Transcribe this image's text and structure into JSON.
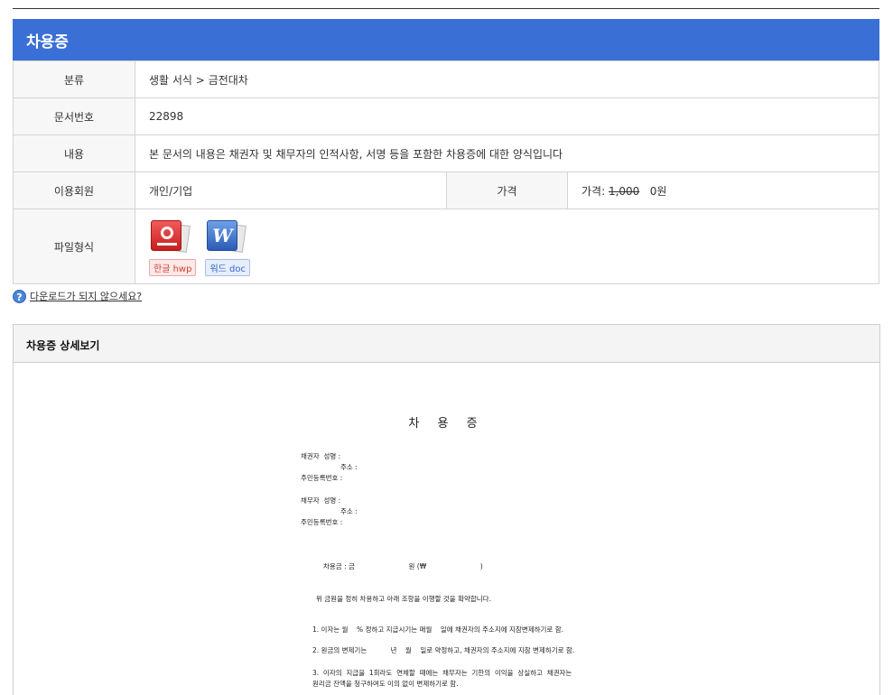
{
  "header": {
    "title": "차용증"
  },
  "info": {
    "category_label": "분류",
    "category_value": "생활 서식 > 금전대차",
    "docno_label": "문서번호",
    "docno_value": "22898",
    "content_label": "내용",
    "content_value": "본 문서의 내용은 채권자 및 채무자의 인적사항, 서명 등을 포함한 차용증에 대한 양식입니다",
    "member_label": "이용회원",
    "member_value": "개인/기업",
    "price_label": "가격",
    "price_prefix": "가격: ",
    "price_original": "1,000",
    "price_final": "0원",
    "fileformat_label": "파일형식",
    "files": [
      {
        "label": "한글 hwp",
        "icon": "hwp-icon"
      },
      {
        "label": "워드 doc",
        "icon": "word-icon"
      }
    ]
  },
  "help": {
    "text": "다운로드가 되지 않으세요?"
  },
  "detail": {
    "title": "차용증 상세보기",
    "doc": {
      "title": "차 용 증",
      "creditor": [
        "채권자  성명 :",
        "주소 :",
        "주민등록번호 :"
      ],
      "debtor": [
        "채무자  성명 :",
        "주소 :",
        "주민등록번호 :"
      ],
      "amount_line": "차용금 : 금                         원 (₩                         )",
      "confirm_line": "위 금원을 정히 차용하고 아래 조항을 이행할 것을 확약합니다.",
      "clause1": "1. 이자는 월    % 정하고 지급시기는 매월    일에 채권자의 주소지에 지참변제하기로 함.",
      "clause2": "2. 원금의 변제기는           년    월    일로 약정하고, 채권자의 주소지에 지참 변제하기로 함.",
      "clause3a": "3.  이자의  지급을  1회라도  연체할  때에는  채무자는  기한의  이익을  상실하고  채권자는",
      "clause3b": "원리금 잔액을 청구하여도 이의 없이 변제하기로 함."
    }
  }
}
